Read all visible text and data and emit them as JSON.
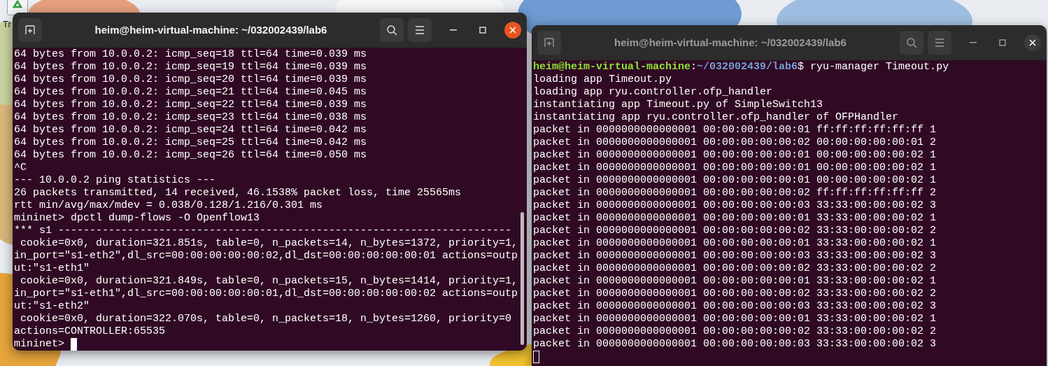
{
  "desktop": {
    "icons": [
      {
        "label": "Tr"
      }
    ]
  },
  "windows": [
    {
      "title": "heim@heim-virtual-machine: ~/032002439/lab6",
      "active": true,
      "scrollbar": true,
      "lines": [
        {
          "kind": "output",
          "text": "64 bytes from 10.0.0.2: icmp_seq=18 ttl=64 time=0.039 ms"
        },
        {
          "kind": "output",
          "text": "64 bytes from 10.0.0.2: icmp_seq=19 ttl=64 time=0.039 ms"
        },
        {
          "kind": "output",
          "text": "64 bytes from 10.0.0.2: icmp_seq=20 ttl=64 time=0.039 ms"
        },
        {
          "kind": "output",
          "text": "64 bytes from 10.0.0.2: icmp_seq=21 ttl=64 time=0.045 ms"
        },
        {
          "kind": "output",
          "text": "64 bytes from 10.0.0.2: icmp_seq=22 ttl=64 time=0.039 ms"
        },
        {
          "kind": "output",
          "text": "64 bytes from 10.0.0.2: icmp_seq=23 ttl=64 time=0.038 ms"
        },
        {
          "kind": "output",
          "text": "64 bytes from 10.0.0.2: icmp_seq=24 ttl=64 time=0.042 ms"
        },
        {
          "kind": "output",
          "text": "64 bytes from 10.0.0.2: icmp_seq=25 ttl=64 time=0.042 ms"
        },
        {
          "kind": "output",
          "text": "64 bytes from 10.0.0.2: icmp_seq=26 ttl=64 time=0.050 ms"
        },
        {
          "kind": "output",
          "text": "^C"
        },
        {
          "kind": "output",
          "text": "--- 10.0.0.2 ping statistics ---"
        },
        {
          "kind": "output",
          "text": "26 packets transmitted, 14 received, 46.1538% packet loss, time 25565ms"
        },
        {
          "kind": "output",
          "text": "rtt min/avg/max/mdev = 0.038/0.128/1.216/0.301 ms"
        },
        {
          "kind": "output",
          "text": "mininet> dpctl dump-flows -O Openflow13"
        },
        {
          "kind": "output",
          "text": "*** s1 ------------------------------------------------------------------------"
        },
        {
          "kind": "output",
          "text": " cookie=0x0, duration=321.851s, table=0, n_packets=14, n_bytes=1372, priority=1,"
        },
        {
          "kind": "output",
          "text": "in_port=\"s1-eth2\",dl_src=00:00:00:00:00:02,dl_dst=00:00:00:00:00:01 actions=outp"
        },
        {
          "kind": "output",
          "text": "ut:\"s1-eth1\""
        },
        {
          "kind": "output",
          "text": " cookie=0x0, duration=321.849s, table=0, n_packets=15, n_bytes=1414, priority=1,"
        },
        {
          "kind": "output",
          "text": "in_port=\"s1-eth1\",dl_src=00:00:00:00:00:01,dl_dst=00:00:00:00:00:02 actions=outp"
        },
        {
          "kind": "output",
          "text": "ut:\"s1-eth2\""
        },
        {
          "kind": "output",
          "text": " cookie=0x0, duration=322.070s, table=0, n_packets=18, n_bytes=1260, priority=0"
        },
        {
          "kind": "output",
          "text": "actions=CONTROLLER:65535"
        },
        {
          "kind": "cursor",
          "text": "mininet> "
        }
      ]
    },
    {
      "title": "heim@heim-virtual-machine: ~/032002439/lab6",
      "active": false,
      "scrollbar": false,
      "lines": [
        {
          "kind": "prompt",
          "user": "heim@heim-virtual-machine",
          "sep": ":",
          "path": "~/032002439/lab6",
          "command": "$ ryu-manager Timeout.py"
        },
        {
          "kind": "output",
          "text": "loading app Timeout.py"
        },
        {
          "kind": "output",
          "text": "loading app ryu.controller.ofp_handler"
        },
        {
          "kind": "output",
          "text": "instantiating app Timeout.py of SimpleSwitch13"
        },
        {
          "kind": "output",
          "text": "instantiating app ryu.controller.ofp_handler of OFPHandler"
        },
        {
          "kind": "output",
          "text": "packet in 0000000000000001 00:00:00:00:00:01 ff:ff:ff:ff:ff:ff 1"
        },
        {
          "kind": "output",
          "text": "packet in 0000000000000001 00:00:00:00:00:02 00:00:00:00:00:01 2"
        },
        {
          "kind": "output",
          "text": "packet in 0000000000000001 00:00:00:00:00:01 00:00:00:00:00:02 1"
        },
        {
          "kind": "output",
          "text": "packet in 0000000000000001 00:00:00:00:00:01 00:00:00:00:00:02 1"
        },
        {
          "kind": "output",
          "text": "packet in 0000000000000001 00:00:00:00:00:01 00:00:00:00:00:02 1"
        },
        {
          "kind": "output",
          "text": "packet in 0000000000000001 00:00:00:00:00:02 ff:ff:ff:ff:ff:ff 2"
        },
        {
          "kind": "output",
          "text": "packet in 0000000000000001 00:00:00:00:00:03 33:33:00:00:00:02 3"
        },
        {
          "kind": "output",
          "text": "packet in 0000000000000001 00:00:00:00:00:01 33:33:00:00:00:02 1"
        },
        {
          "kind": "output",
          "text": "packet in 0000000000000001 00:00:00:00:00:02 33:33:00:00:00:02 2"
        },
        {
          "kind": "output",
          "text": "packet in 0000000000000001 00:00:00:00:00:01 33:33:00:00:00:02 1"
        },
        {
          "kind": "output",
          "text": "packet in 0000000000000001 00:00:00:00:00:03 33:33:00:00:00:02 3"
        },
        {
          "kind": "output",
          "text": "packet in 0000000000000001 00:00:00:00:00:02 33:33:00:00:00:02 2"
        },
        {
          "kind": "output",
          "text": "packet in 0000000000000001 00:00:00:00:00:01 33:33:00:00:00:02 1"
        },
        {
          "kind": "output",
          "text": "packet in 0000000000000001 00:00:00:00:00:02 33:33:00:00:00:02 2"
        },
        {
          "kind": "output",
          "text": "packet in 0000000000000001 00:00:00:00:00:03 33:33:00:00:00:02 3"
        },
        {
          "kind": "output",
          "text": "packet in 0000000000000001 00:00:00:00:00:01 33:33:00:00:00:02 1"
        },
        {
          "kind": "output",
          "text": "packet in 0000000000000001 00:00:00:00:00:02 33:33:00:00:00:02 2"
        },
        {
          "kind": "output",
          "text": "packet in 0000000000000001 00:00:00:00:00:03 33:33:00:00:00:02 3"
        },
        {
          "kind": "cursor"
        }
      ]
    }
  ]
}
